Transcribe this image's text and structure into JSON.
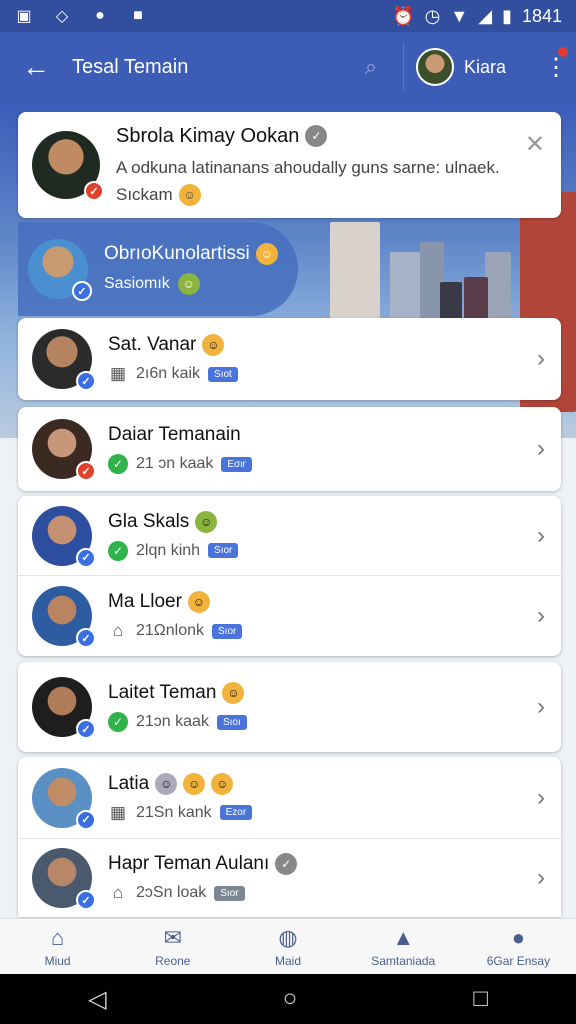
{
  "status": {
    "time": "1841"
  },
  "appbar": {
    "title": "Tesal Temain",
    "profile_name": "Kiara"
  },
  "top_card": {
    "name": "Sbrola Kimay Ookan",
    "line1": "A odkuna latinanans ahoudally guns sarne: ulnaek.",
    "line2": "Sıckam"
  },
  "featured": {
    "name": "ObrıoKunolartissi",
    "sub": "Sasiomık"
  },
  "friends": [
    {
      "name": "Sat. Vanar",
      "status": "2ı6n kaik",
      "tag": "Sıot"
    },
    {
      "name": "Daiar Temanain",
      "status": "21 ɔn kaak",
      "tag": "Εσιr"
    },
    {
      "name": "Gla Skals",
      "status": "2lqn kinh",
      "tag": "Sıor"
    },
    {
      "name": "Ma Lloer",
      "status": "21Ωnlonk",
      "tag": "Sıor"
    },
    {
      "name": "Laitet Teman",
      "status": "21ɔn kaak",
      "tag": "Sıoı"
    },
    {
      "name": "Latia",
      "status": "21Sn kank",
      "tag": "Ezor"
    },
    {
      "name": "Hapr Teman Aulanı",
      "status": "2ɔSn loak",
      "tag": "Sıor"
    }
  ],
  "nav": [
    {
      "label": "Miud"
    },
    {
      "label": "Reone"
    },
    {
      "label": "Maid"
    },
    {
      "label": "Samtaniada"
    },
    {
      "label": "6Gar Ensay"
    }
  ]
}
